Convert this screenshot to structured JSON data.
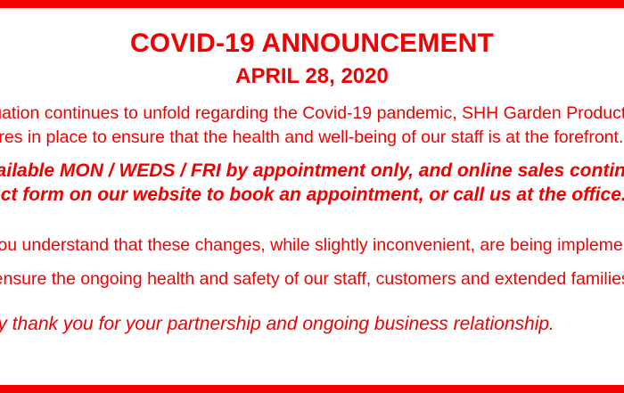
{
  "colors": {
    "accent": "#f40000",
    "text": "#f00000",
    "background": "#ffffff"
  },
  "announcement": {
    "title": "COVID-19 ANNOUNCEMENT",
    "date": "APRIL 28, 2020",
    "paragraph1": [
      "As the situation continues to unfold regarding the Covid-19 pandemic, SHH Garden Products",
      "has measures in place to ensure that the health and well-being of our staff is at the forefront."
    ],
    "emphasis": [
      "We are available MON / WEDS / FRI by appointment only, and online sales continue.",
      "Use the contact form on our website to book an appointment, or call us at the office."
    ],
    "paragraph2": [
      "We trust you understand that these changes, while slightly inconvenient, are being implemented",
      "to ensure the  ongoing health and safety of our staff, customers and extended families."
    ],
    "thanks": "We sincerely thank you for your partnership and ongoing business relationship."
  }
}
